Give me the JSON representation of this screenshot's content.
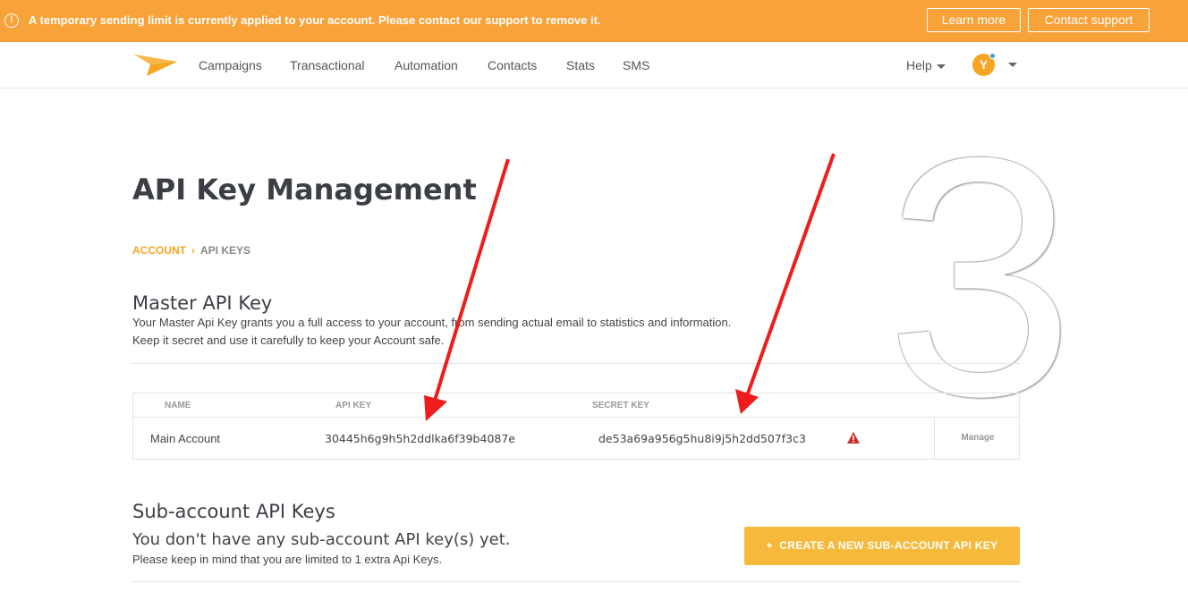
{
  "banner": {
    "icon": "exclamation-circle-icon",
    "message": "A temporary sending limit is currently applied to your account. Please contact our support to remove it.",
    "learn_more": "Learn more",
    "contact_support": "Contact support",
    "color": "#f8a33a"
  },
  "nav": {
    "logo": "paper-plane-logo",
    "items": [
      "Campaigns",
      "Transactional",
      "Automation",
      "Contacts",
      "Stats",
      "SMS"
    ],
    "help": "Help",
    "avatar_letter": "Y"
  },
  "overlay_number": "3",
  "page": {
    "title": "API Key Management",
    "breadcrumb": [
      "ACCOUNT",
      "API KEYS"
    ]
  },
  "master": {
    "title": "Master API Key",
    "desc_line1": "Your Master Api Key grants you a full access to your account, from sending actual email to statistics and information.",
    "desc_line2": "Keep it secret and use it carefully to keep your Account safe.",
    "columns": [
      "NAME",
      "API KEY",
      "SECRET KEY"
    ],
    "row": {
      "name": "Main Account",
      "api_key": "30445h6g9h5h2ddlka6f39b4087e",
      "secret_key": "de53a69a956g5hu8i9j5h2dd507f3c3",
      "warning_icon": "warning-triangle-icon",
      "manage": "Manage"
    }
  },
  "sub": {
    "title": "Sub-account API Keys",
    "empty": "You don't have any sub-account API key(s) yet.",
    "note": "Please keep in mind that you are limited to 1 extra Api Keys.",
    "create_button": "CREATE A NEW SUB-ACCOUNT API KEY",
    "create_icon": "+"
  },
  "annotation_color": "#ee1c1c",
  "accent": "#f6a623"
}
